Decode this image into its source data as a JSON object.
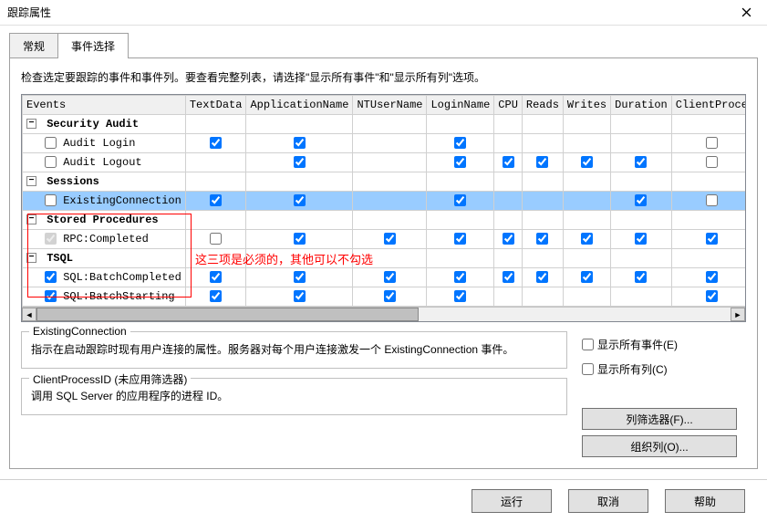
{
  "window": {
    "title": "跟踪属性"
  },
  "tabs": {
    "general": "常规",
    "events": "事件选择",
    "active": 1
  },
  "instruction": "检查选定要跟踪的事件和事件列。要查看完整列表，请选择\"显示所有事件\"和\"显示所有列\"选项。",
  "columns": [
    "Events",
    "TextData",
    "ApplicationName",
    "NTUserName",
    "LoginName",
    "CPU",
    "Reads",
    "Writes",
    "Duration",
    "ClientProce"
  ],
  "rows": [
    {
      "type": "group",
      "label": "Security Audit"
    },
    {
      "type": "leaf",
      "label": "Audit Login",
      "cells": [
        "u",
        "c",
        "c",
        "",
        "c",
        "",
        "",
        "",
        "",
        "u"
      ]
    },
    {
      "type": "leaf",
      "label": "Audit Logout",
      "cells": [
        "u",
        "",
        "c",
        "",
        "c",
        "c",
        "c",
        "c",
        "c",
        "u"
      ]
    },
    {
      "type": "group",
      "label": "Sessions"
    },
    {
      "type": "leaf",
      "label": "ExistingConnection",
      "selected": true,
      "cells": [
        "u",
        "c",
        "c",
        "",
        "c",
        "",
        "",
        "",
        "c",
        "u"
      ]
    },
    {
      "type": "group",
      "label": "Stored Procedures"
    },
    {
      "type": "leaf",
      "label": "RPC:Completed",
      "cells": [
        "cd",
        "u",
        "c",
        "c",
        "c",
        "c",
        "c",
        "c",
        "c",
        "c"
      ]
    },
    {
      "type": "group",
      "label": "TSQL"
    },
    {
      "type": "leaf",
      "label": "SQL:BatchCompleted",
      "cells": [
        "c",
        "c",
        "c",
        "c",
        "c",
        "c",
        "c",
        "c",
        "c",
        "c"
      ]
    },
    {
      "type": "leaf",
      "label": "SQL:BatchStarting",
      "cells": [
        "c",
        "c",
        "c",
        "c",
        "c",
        "",
        "",
        "",
        "",
        "c"
      ]
    }
  ],
  "annotation": "这三项是必须的，其他可以不勾选",
  "desc_box": {
    "title": "ExistingConnection",
    "text": "指示在启动跟踪时现有用户连接的属性。服务器对每个用户连接激发一个 ExistingConnection 事件。"
  },
  "filter_box": {
    "title": "ClientProcessID (未应用筛选器)",
    "text": "调用 SQL Server 的应用程序的进程 ID。"
  },
  "checkboxes": {
    "show_all_events": "显示所有事件(E)",
    "show_all_cols": "显示所有列(C)"
  },
  "buttons": {
    "col_filter": "列筛选器(F)...",
    "organize_cols": "组织列(O)...",
    "run": "运行",
    "cancel": "取消",
    "help": "帮助"
  }
}
